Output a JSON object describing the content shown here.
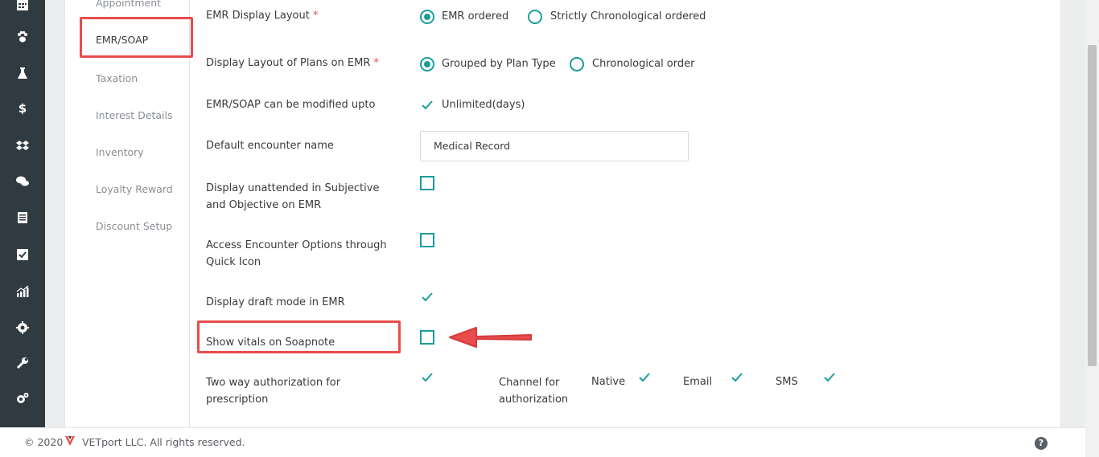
{
  "sidebar": {
    "items": [
      {
        "label": "Appointment"
      },
      {
        "label": "EMR/SOAP"
      },
      {
        "label": "Taxation"
      },
      {
        "label": "Interest Details"
      },
      {
        "label": "Inventory"
      },
      {
        "label": "Loyalty Reward"
      },
      {
        "label": "Discount Setup"
      }
    ],
    "active": "EMR/SOAP"
  },
  "rail": {
    "icons": [
      "calendar-icon",
      "paw-icon",
      "flask-icon",
      "dollar-icon",
      "dropbox-icon",
      "chat-icon",
      "receipt-icon",
      "checkbox-icon",
      "chart-icon",
      "gear-icon",
      "wrench-icon",
      "gears-icon"
    ],
    "dollar_glyph": "$"
  },
  "settings": {
    "display_layout": {
      "label": "EMR Display Layout",
      "required_mark": "*",
      "options": [
        "EMR ordered",
        "Strictly Chronological ordered"
      ],
      "selected": "EMR ordered"
    },
    "plans_layout": {
      "label": "Display Layout of Plans on EMR",
      "required_mark": "*",
      "options": [
        "Grouped by Plan Type",
        "Chronological order"
      ],
      "selected": "Grouped by Plan Type"
    },
    "modify_upto": {
      "label": "EMR/SOAP can be modified upto",
      "value": "Unlimited(days)",
      "checked": true
    },
    "default_encounter": {
      "label": "Default encounter name",
      "value": "Medical Record"
    },
    "unattended": {
      "label": "Display unattended in Subjective and Objective on EMR",
      "checked": false
    },
    "quick_icon": {
      "label": "Access Encounter Options through Quick Icon",
      "checked": false
    },
    "draft_mode": {
      "label": "Display draft mode in EMR",
      "checked": true
    },
    "vitals": {
      "label": "Show vitals on Soapnote",
      "checked": false
    },
    "two_way_auth": {
      "label": "Two way authorization for prescription",
      "checked": true,
      "channel_label": "Channel for authorization",
      "channels": [
        {
          "label": "Native",
          "checked": true
        },
        {
          "label": "Email",
          "checked": true
        },
        {
          "label": "SMS",
          "checked": true
        }
      ]
    }
  },
  "footer": {
    "copyright_prefix": "© 2020",
    "copyright_suffix": "VETport LLC. All rights reserved.",
    "help_glyph": "?"
  },
  "colors": {
    "accent": "#1a9e9b",
    "highlight": "#e84c4c",
    "rail_bg": "#2f3b40"
  }
}
